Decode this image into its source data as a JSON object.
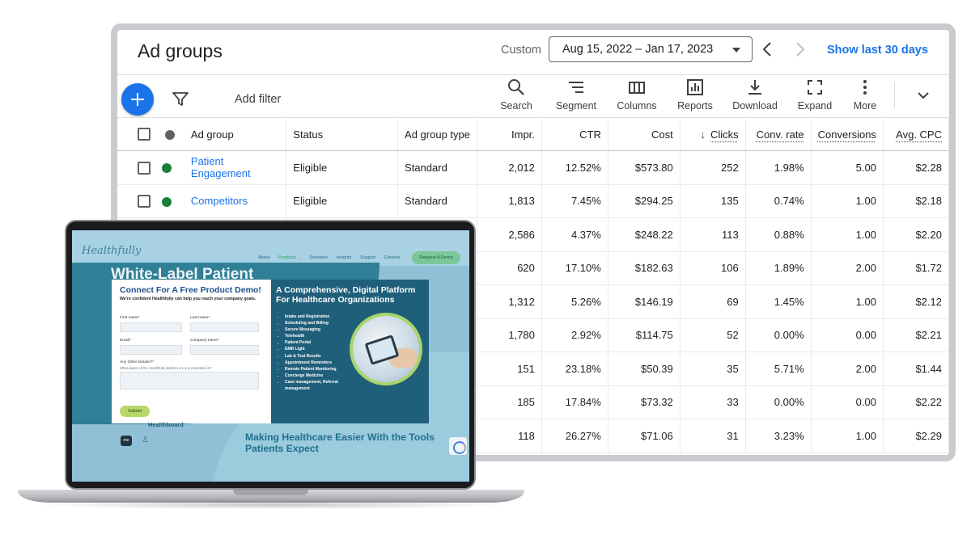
{
  "ads": {
    "title": "Ad groups",
    "custom_label": "Custom",
    "date_range": "Aug 15, 2022 – Jan 17, 2023",
    "show_last": "Show last 30 days",
    "add_filter": "Add filter",
    "tools": {
      "search": "Search",
      "segment": "Segment",
      "columns": "Columns",
      "reports": "Reports",
      "download": "Download",
      "expand": "Expand",
      "more": "More"
    },
    "columns": [
      "Ad group",
      "Status",
      "Ad group type",
      "Impr.",
      "CTR",
      "Cost",
      "Clicks",
      "Conv. rate",
      "Conversions",
      "Avg. CPC"
    ],
    "rows": [
      {
        "ad_group": "Patient Engagement",
        "status": "Eligible",
        "type": "Standard",
        "impr": "2,012",
        "ctr": "12.52%",
        "cost": "$573.80",
        "clicks": "252",
        "conv_rate": "1.98%",
        "conversions": "5.00",
        "avg_cpc": "$2.28"
      },
      {
        "ad_group": "Competitors",
        "status": "Eligible",
        "type": "Standard",
        "impr": "1,813",
        "ctr": "7.45%",
        "cost": "$294.25",
        "clicks": "135",
        "conv_rate": "0.74%",
        "conversions": "1.00",
        "avg_cpc": "$2.18"
      },
      {
        "impr": "2,586",
        "ctr": "4.37%",
        "cost": "$248.22",
        "clicks": "113",
        "conv_rate": "0.88%",
        "conversions": "1.00",
        "avg_cpc": "$2.20"
      },
      {
        "impr": "620",
        "ctr": "17.10%",
        "cost": "$182.63",
        "clicks": "106",
        "conv_rate": "1.89%",
        "conversions": "2.00",
        "avg_cpc": "$1.72"
      },
      {
        "impr": "1,312",
        "ctr": "5.26%",
        "cost": "$146.19",
        "clicks": "69",
        "conv_rate": "1.45%",
        "conversions": "1.00",
        "avg_cpc": "$2.12"
      },
      {
        "impr": "1,780",
        "ctr": "2.92%",
        "cost": "$114.75",
        "clicks": "52",
        "conv_rate": "0.00%",
        "conversions": "0.00",
        "avg_cpc": "$2.21"
      },
      {
        "impr": "151",
        "ctr": "23.18%",
        "cost": "$50.39",
        "clicks": "35",
        "conv_rate": "5.71%",
        "conversions": "2.00",
        "avg_cpc": "$1.44"
      },
      {
        "impr": "185",
        "ctr": "17.84%",
        "cost": "$73.32",
        "clicks": "33",
        "conv_rate": "0.00%",
        "conversions": "0.00",
        "avg_cpc": "$2.22"
      },
      {
        "impr": "118",
        "ctr": "26.27%",
        "cost": "$71.06",
        "clicks": "31",
        "conv_rate": "3.23%",
        "conversions": "1.00",
        "avg_cpc": "$2.29"
      }
    ],
    "colors": {
      "accent": "#1a73e8",
      "status_green": "#188038",
      "status_grey": "#5f6368"
    }
  },
  "site": {
    "logo": "Healthfully",
    "nav": [
      "About",
      "Products ⌄",
      "Solutions",
      "Insights",
      "Support",
      "Careers"
    ],
    "cta": "Request A Demo",
    "hero_title": "White-Label Patient",
    "form": {
      "title": "Connect For A Free Product Demo!",
      "subtitle": "We're confident Healthfully can help you reach your company goals.",
      "first_name": "First name*",
      "last_name": "Last name*",
      "email": "Email*",
      "company": "Company name*",
      "other": "Any Other Details?*",
      "other_hint": "What aspect of the Healthfully platform are you interested in?",
      "submit": "Submit"
    },
    "info": {
      "title": "A Comprehensive, Digital Platform For Healthcare Organizations",
      "items": [
        "Intake and Registration",
        "Scheduling and Billing",
        "Secure Messaging",
        "Telehealth",
        "Patient Portal",
        "EMR Light",
        "Lab & Test Results",
        "Appointment Reminders",
        "Remote Patient Monitoring",
        "Concierge Medicine",
        "Case management, Referral management"
      ]
    },
    "healthboard": "Healthboard",
    "app_badge": "me",
    "tagline": "Making Healthcare Easier With the Tools Patients Expect"
  }
}
